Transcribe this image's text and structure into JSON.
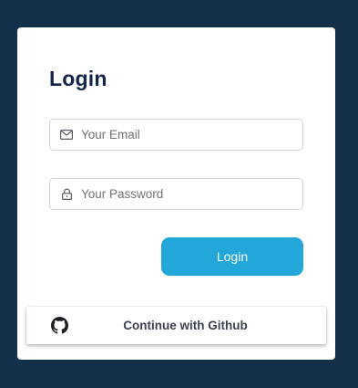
{
  "login_card": {
    "title": "Login",
    "email_field": {
      "icon": "envelope-icon",
      "placeholder": "Your Email",
      "value": ""
    },
    "password_field": {
      "icon": "lock-icon",
      "placeholder": "Your Password",
      "value": ""
    },
    "login_button": {
      "label": "Login"
    },
    "github_button": {
      "icon": "github-icon",
      "label": "Continue with Github"
    }
  },
  "colors": {
    "background": "#15304b",
    "card": "#ffffff",
    "title": "#15244a",
    "primary_button": "#22a7d8",
    "github_text": "#3c4252"
  }
}
